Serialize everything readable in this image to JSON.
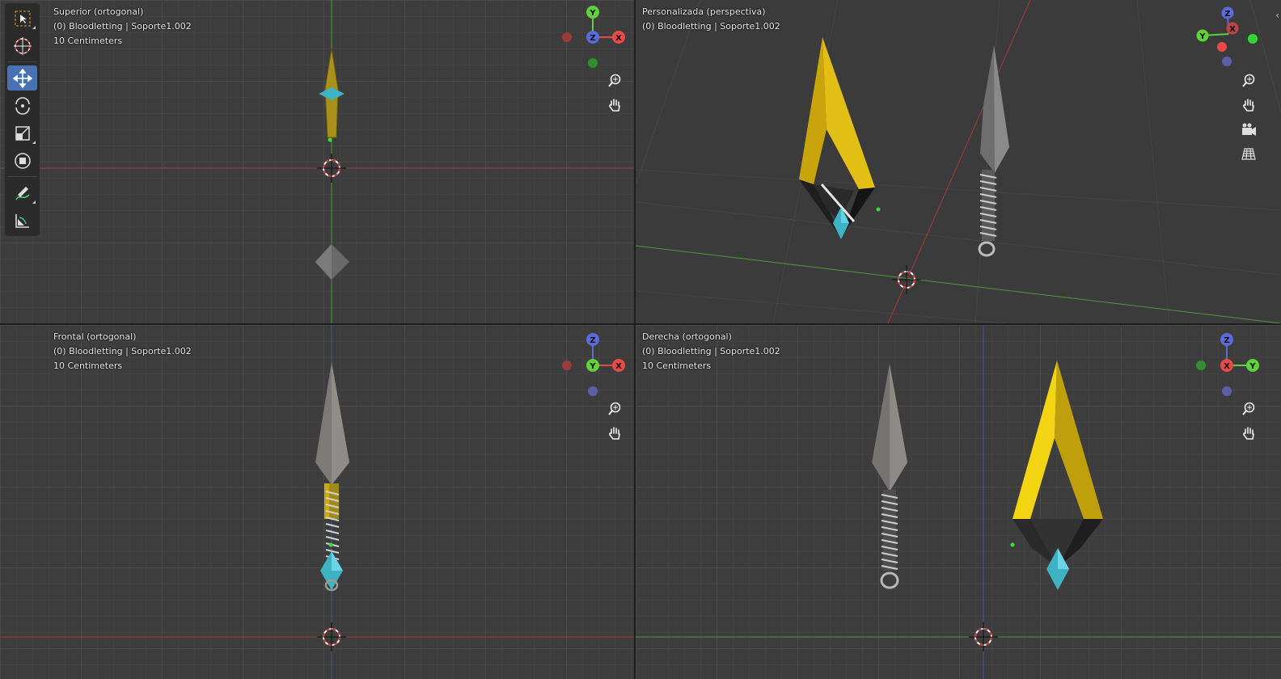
{
  "viewports": {
    "top": {
      "view_name": "Superior (ortogonal)",
      "object_line": "(0) Bloodletting | Soporte1.002",
      "scale": "10 Centimeters"
    },
    "perspective": {
      "view_name": "Personalizada (perspectiva)",
      "object_line": "(0) Bloodletting | Soporte1.002"
    },
    "front": {
      "view_name": "Frontal (ortogonal)",
      "object_line": "(0) Bloodletting | Soporte1.002",
      "scale": "10 Centimeters"
    },
    "right": {
      "view_name": "Derecha (ortogonal)",
      "object_line": "(0) Bloodletting | Soporte1.002",
      "scale": "10 Centimeters"
    }
  },
  "gizmo_labels": {
    "x": "X",
    "y": "Y",
    "z": "Z"
  },
  "colors": {
    "x_axis": "#e84a4a",
    "y_axis": "#5fd13b",
    "z_axis": "#5b6bd8",
    "active_tool": "#4772b3",
    "gold": "#d9b50a",
    "gem": "#3fb2c4"
  },
  "toolbar": {
    "tools": [
      "select-box-icon",
      "cursor-icon",
      "move-icon",
      "rotate-icon",
      "scale-icon",
      "transform-icon",
      "annotate-icon",
      "measure-icon"
    ],
    "active": "move-icon"
  },
  "nav_icons": [
    "zoom-icon",
    "pan-hand-icon",
    "camera-icon",
    "grid-icon"
  ]
}
